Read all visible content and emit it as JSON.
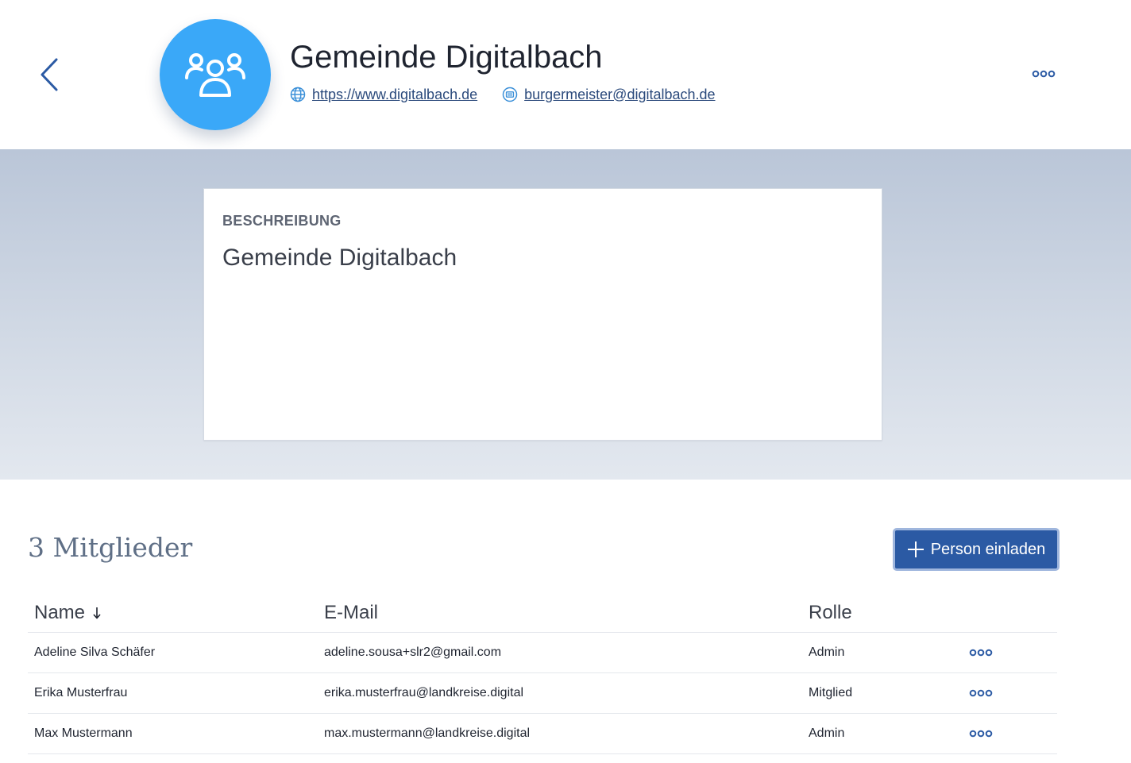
{
  "header": {
    "title": "Gemeinde Digitalbach",
    "website": "https://www.digitalbach.de",
    "email": "burgermeister@digitalbach.de",
    "icons": {
      "back": "chevron-left-icon",
      "avatar": "group-icon",
      "website": "globe-icon",
      "email": "mail-icon",
      "more": "more-horizontal-icon"
    }
  },
  "description": {
    "label": "BESCHREIBUNG",
    "text": "Gemeinde Digitalbach"
  },
  "members": {
    "title": "3 Mitglieder",
    "invite_label": "Person einladen",
    "invite_icon": "plus-icon",
    "columns": {
      "name": "Name",
      "email": "E-Mail",
      "role": "Rolle"
    },
    "sort_icon": "arrow-down-icon",
    "rows": [
      {
        "name": "Adeline Silva Schäfer",
        "email": "adeline.sousa+slr2@gmail.com",
        "role": "Admin"
      },
      {
        "name": "Erika Musterfrau",
        "email": "erika.musterfrau@landkreise.digital",
        "role": "Mitglied"
      },
      {
        "name": "Max Mustermann",
        "email": "max.mustermann@landkreise.digital",
        "role": "Admin"
      }
    ]
  },
  "colors": {
    "accent": "#3aa8f8",
    "primary_button": "#2b5aa4",
    "link": "#2b4a7c"
  }
}
